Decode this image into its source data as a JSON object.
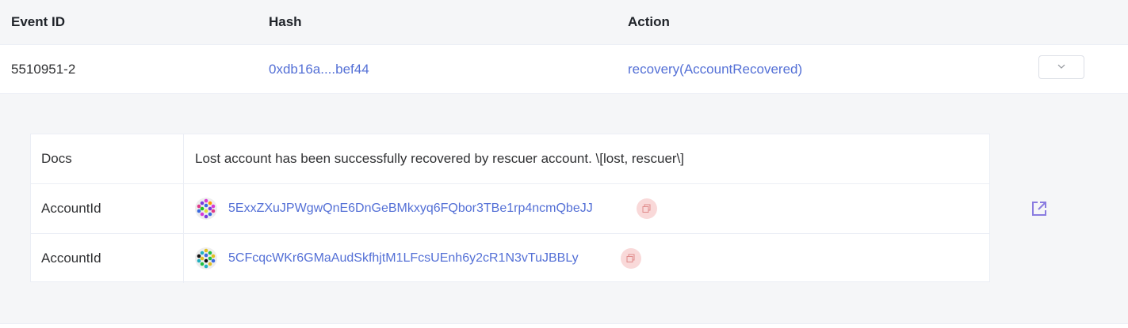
{
  "table": {
    "headers": {
      "event_id": "Event ID",
      "hash": "Hash",
      "action": "Action"
    },
    "row": {
      "event_id": "5510951-2",
      "hash": "0xdb16a....bef44",
      "action": "recovery(AccountRecovered)"
    }
  },
  "params": [
    {
      "key": "Docs",
      "value": "Lost account has been successfully recovered by rescuer account. \\[lost, rescuer\\]"
    },
    {
      "key": "AccountId",
      "address": "5ExxZXuJPWgwQnE6DnGeBMkxyq6FQbor3TBe1rp4ncmQbeJJ",
      "avatar_icon": "identicon-icon"
    },
    {
      "key": "AccountId",
      "address": "5CFcqcWKr6GMaAudSkfhjtM1LFcsUEnh6y2cR1N3vTuJBBLy",
      "avatar_icon": "identicon-icon"
    }
  ],
  "colors": {
    "link": "#5470d6",
    "header_bg": "#f5f6f8",
    "copy_bg": "#f9d9d9",
    "external_icon": "#8a7ce0"
  },
  "icons": {
    "expand": "chevron-down-icon",
    "copy": "copy-icon",
    "external": "external-link-icon"
  }
}
